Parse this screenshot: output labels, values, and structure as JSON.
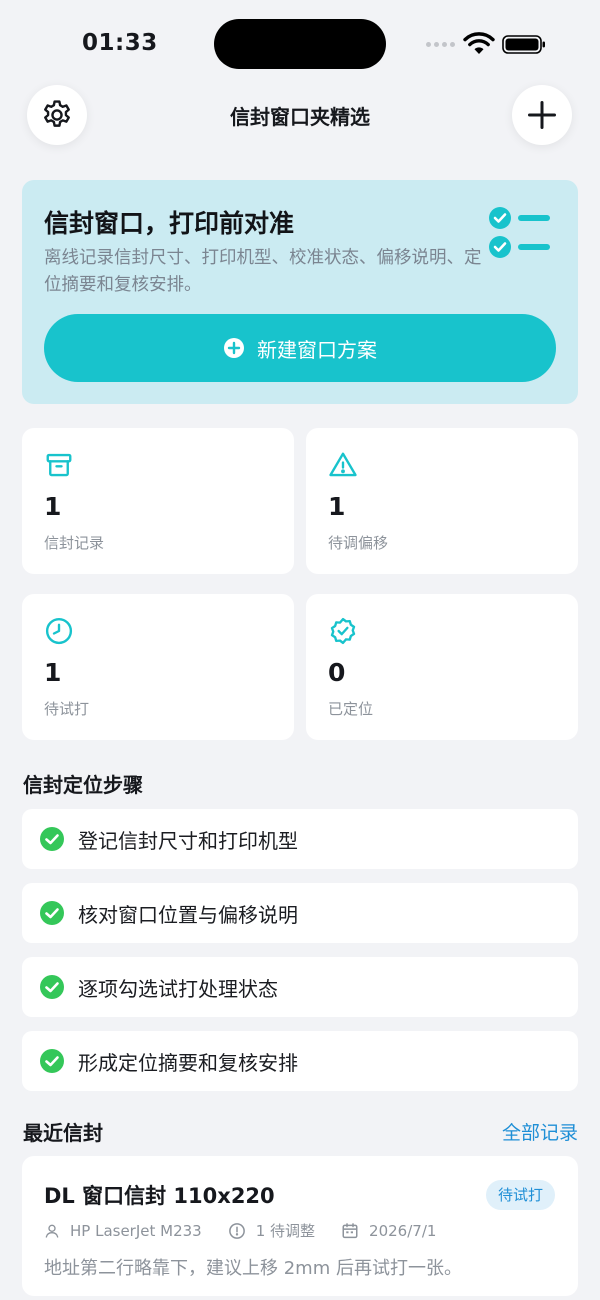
{
  "status_bar": {
    "time": "01:33"
  },
  "header": {
    "title": "信封窗口夹精选",
    "settings_icon": "gear-icon",
    "add_icon": "plus-icon"
  },
  "hero": {
    "title": "信封窗口，打印前对准",
    "description": "离线记录信封尺寸、打印机型、校准状态、偏移说明、定位摘要和复核安排。",
    "button_label": "新建窗口方案",
    "icon": "checklist-icon"
  },
  "stats": [
    {
      "icon": "archive-icon",
      "value": "1",
      "label": "信封记录"
    },
    {
      "icon": "warning-icon",
      "value": "1",
      "label": "待调偏移"
    },
    {
      "icon": "clock-icon",
      "value": "1",
      "label": "待试打"
    },
    {
      "icon": "verified-badge-icon",
      "value": "0",
      "label": "已定位"
    }
  ],
  "steps_section": {
    "title": "信封定位步骤",
    "steps": [
      "登记信封尺寸和打印机型",
      "核对窗口位置与偏移说明",
      "逐项勾选试打处理状态",
      "形成定位摘要和复核安排"
    ]
  },
  "recent_section": {
    "title": "最近信封",
    "see_all": "全部记录",
    "items": [
      {
        "title": "DL 窗口信封 110x220",
        "status": "待试打",
        "printer": "HP LaserJet M233",
        "pending": "1 待调整",
        "date": "2026/7/1",
        "note": "地址第二行略靠下，建议上移 2mm 后再试打一张。"
      }
    ]
  },
  "colors": {
    "accent": "#18c3cc",
    "hero_bg": "#cbebf2",
    "link": "#1f8fd6",
    "success": "#34c759"
  }
}
